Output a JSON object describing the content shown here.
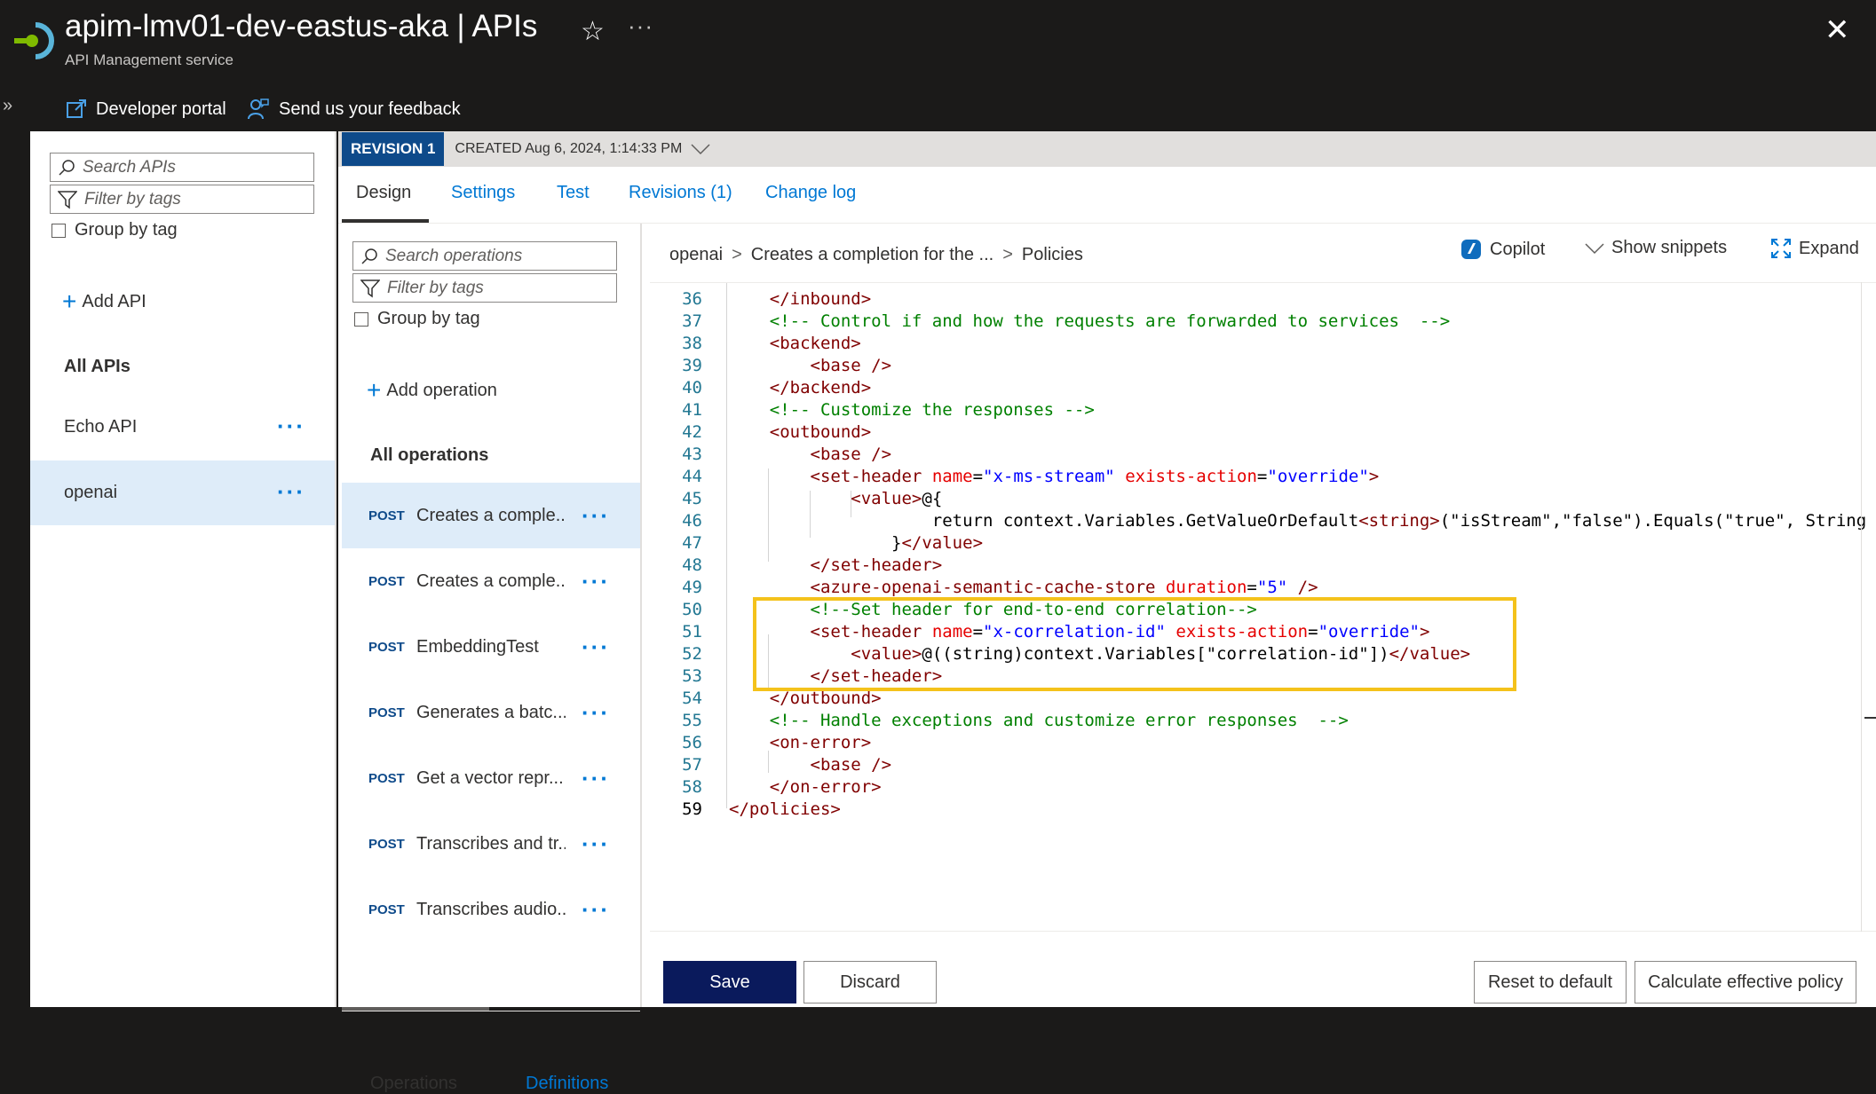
{
  "header": {
    "title": "apim-lmv01-dev-eastus-aka | APIs",
    "subtitle": "API Management service",
    "more": "···",
    "close": "✕"
  },
  "commands": {
    "developer_portal": "Developer portal",
    "feedback": "Send us your feedback"
  },
  "apis_panel": {
    "search_placeholder": "Search APIs",
    "filter_placeholder": "Filter by tags",
    "group_by_tag": "Group by tag",
    "add_api": "Add API",
    "all_apis": "All APIs",
    "items": [
      {
        "label": "Echo API"
      },
      {
        "label": "openai"
      }
    ]
  },
  "revision": {
    "badge": "REVISION 1",
    "created": "CREATED Aug 6, 2024, 1:14:33 PM"
  },
  "tabs": [
    "Design",
    "Settings",
    "Test",
    "Revisions (1)",
    "Change log"
  ],
  "operations_panel": {
    "search_placeholder": "Search operations",
    "filter_placeholder": "Filter by tags",
    "group_by_tag": "Group by tag",
    "add_operation": "Add operation",
    "all_operations": "All operations",
    "items": [
      {
        "verb": "POST",
        "name": "Creates a comple..."
      },
      {
        "verb": "POST",
        "name": "Creates a comple..."
      },
      {
        "verb": "POST",
        "name": "EmbeddingTest"
      },
      {
        "verb": "POST",
        "name": "Generates a batc..."
      },
      {
        "verb": "POST",
        "name": "Get a vector repr..."
      },
      {
        "verb": "POST",
        "name": "Transcribes and tr..."
      },
      {
        "verb": "POST",
        "name": "Transcribes audio..."
      }
    ],
    "bottom_tabs": [
      "Operations",
      "Definitions"
    ]
  },
  "breadcrumb": [
    "openai",
    "Creates a completion for the ...",
    "Policies"
  ],
  "toolbar": {
    "copilot": "Copilot",
    "snippets": "Show snippets",
    "expand": "Expand"
  },
  "code_lines": [
    {
      "n": "36",
      "text": "    </inbound>"
    },
    {
      "n": "37",
      "text": "    <!-- Control if and how the requests are forwarded to services  -->"
    },
    {
      "n": "38",
      "text": "    <backend>"
    },
    {
      "n": "39",
      "text": "        <base />"
    },
    {
      "n": "40",
      "text": "    </backend>"
    },
    {
      "n": "41",
      "text": "    <!-- Customize the responses -->"
    },
    {
      "n": "42",
      "text": "    <outbound>"
    },
    {
      "n": "43",
      "text": "        <base />"
    },
    {
      "n": "44",
      "text": "        <set-header name=\"x-ms-stream\" exists-action=\"override\">"
    },
    {
      "n": "45",
      "text": "            <value>@{"
    },
    {
      "n": "46",
      "text": "                    return context.Variables.GetValueOrDefault<string>(\"isStream\",\"false\").Equals(\"true\", String"
    },
    {
      "n": "47",
      "text": "                }</value>"
    },
    {
      "n": "48",
      "text": "        </set-header>"
    },
    {
      "n": "49",
      "text": "        <azure-openai-semantic-cache-store duration=\"5\" />"
    },
    {
      "n": "50",
      "text": "        <!--Set header for end-to-end correlation-->"
    },
    {
      "n": "51",
      "text": "        <set-header name=\"x-correlation-id\" exists-action=\"override\">"
    },
    {
      "n": "52",
      "text": "            <value>@((string)context.Variables[\"correlation-id\"])</value>"
    },
    {
      "n": "53",
      "text": "        </set-header>"
    },
    {
      "n": "54",
      "text": "    </outbound>"
    },
    {
      "n": "55",
      "text": "    <!-- Handle exceptions and customize error responses  -->"
    },
    {
      "n": "56",
      "text": "    <on-error>"
    },
    {
      "n": "57",
      "text": "        <base />"
    },
    {
      "n": "58",
      "text": "    </on-error>"
    },
    {
      "n": "59",
      "text": "</policies>"
    }
  ],
  "footer": {
    "save": "Save",
    "discard": "Discard",
    "reset": "Reset to default",
    "calculate": "Calculate effective policy"
  },
  "colors": {
    "accent": "#0078d4",
    "save_bg": "#0a1a5c",
    "highlight": "#f4c21b",
    "selected_bg": "#deecf9"
  }
}
